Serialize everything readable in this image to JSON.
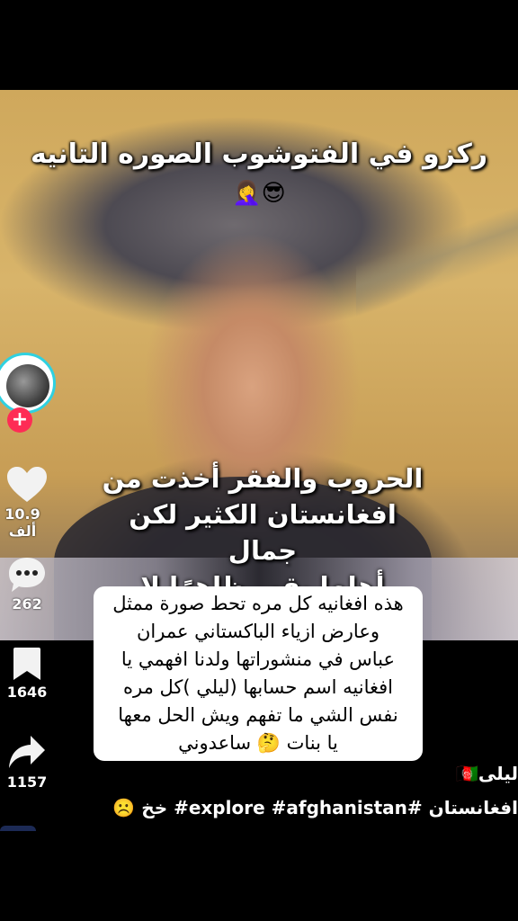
{
  "video": {
    "title_line": "ركزو في الفتوشوب الصوره التانيه",
    "title_emoji": "🤦‍♀️😎",
    "poem_lines": [
      "الحروب والفقر أخذت من",
      "افغانستان الكثير لكن جمال",
      "أهلها بقي ظاهرًا لا يُخفى"
    ],
    "caption_lines": [
      "هذه افغانيه كل مره تحط صورة ممثل",
      "وعارض ازياء الباكستاني عمران",
      "عباس  في منشوراتها ولدنا افهمي يا",
      "افغانيه اسم حسابها (ليلي )كل مره",
      "نفس الشي ما تفهم ويش الحل معها",
      "يا بنات 🤔 ساعدوني"
    ]
  },
  "sidebar": {
    "like_count": "10.9 ألف",
    "comment_count": "262",
    "save_count": "1646",
    "share_count": "1157",
    "plus_label": "+"
  },
  "footer": {
    "username": "ليلى🇦🇫",
    "hashtags": "☹️ خخ #explore #afghanistan# افغانستان"
  },
  "colors": {
    "follow": "#fe2c55",
    "ring": "#2fd1e0"
  }
}
